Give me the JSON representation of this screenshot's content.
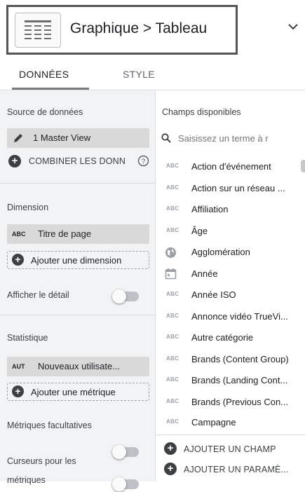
{
  "header": {
    "chart_title": "Graphique > Tableau"
  },
  "tabs": [
    {
      "label": "DONNÉES"
    },
    {
      "label": "STYLE"
    }
  ],
  "data_source": {
    "section_title": "Source de données",
    "source_name": "1 Master View",
    "combine_label": "COMBINER LES DONN"
  },
  "dimension": {
    "section_title": "Dimension",
    "badge": "ABC",
    "chip_label": "Titre de page",
    "add_label": "Ajouter une dimension"
  },
  "drill_down": {
    "label": "Afficher le détail",
    "enabled": false
  },
  "metric": {
    "section_title": "Statistique",
    "badge": "AUT",
    "chip_label": "Nouveaux utilisate...",
    "add_label": "Ajouter une métrique"
  },
  "optional_metrics": {
    "section_title": "Métriques facultatives"
  },
  "sliders": {
    "label": "Curseurs pour les",
    "label2": "métriques"
  },
  "available_fields": {
    "section_title": "Champs disponibles",
    "search_placeholder": "Saisissez un terme à r",
    "items": [
      {
        "icon": "ABC",
        "label": "Action d'événement"
      },
      {
        "icon": "ABC",
        "label": "Action sur un réseau ..."
      },
      {
        "icon": "ABC",
        "label": "Affiliation"
      },
      {
        "icon": "ABC",
        "label": "Âge"
      },
      {
        "icon": "globe",
        "label": "Agglomération"
      },
      {
        "icon": "calendar",
        "label": "Année"
      },
      {
        "icon": "ABC",
        "label": "Année ISO"
      },
      {
        "icon": "ABC",
        "label": "Annonce vidéo TrueVi..."
      },
      {
        "icon": "ABC",
        "label": "Autre catégorie"
      },
      {
        "icon": "ABC",
        "label": "Brands (Content Group)"
      },
      {
        "icon": "ABC",
        "label": "Brands (Landing Cont..."
      },
      {
        "icon": "ABC",
        "label": "Brands (Previous Con..."
      },
      {
        "icon": "ABC",
        "label": "Campagne"
      }
    ],
    "add_field_label": "AJOUTER UN CHAMP",
    "add_param_label": "AJOUTER UN PARAMÈ..."
  },
  "colors": {
    "left_panel_bg": "#f1f3f4",
    "chip_bg": "#d9d9d9",
    "text": "#202124"
  }
}
